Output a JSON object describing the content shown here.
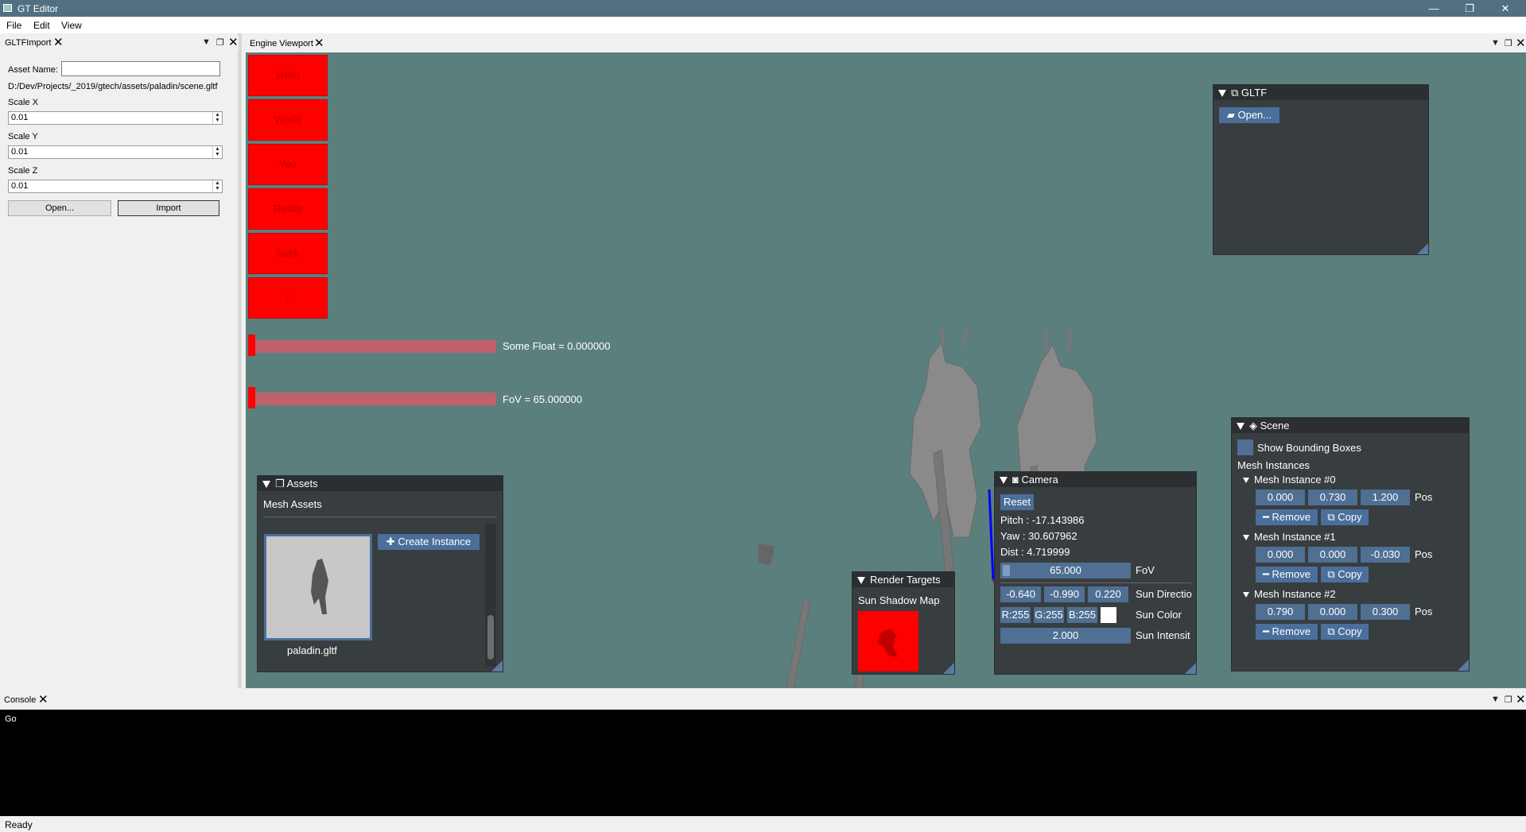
{
  "window": {
    "title": "GT Editor",
    "minimize": "—",
    "restore": "❐",
    "close": "✕"
  },
  "menu": {
    "items": [
      "File",
      "Edit",
      "View"
    ]
  },
  "gltf_import_panel": {
    "tab": "GLTFImport",
    "asset_name_label": "Asset Name:",
    "asset_name_value": "",
    "file_path": "D:/Dev/Projects/_2019/gtech/assets/paladin/scene.gltf",
    "scale_x_label": "Scale X",
    "scale_x": "0.01",
    "scale_y_label": "Scale Y",
    "scale_y": "0.01",
    "scale_z_label": "Scale Z",
    "scale_z": "0.01",
    "open_button": "Open...",
    "import_button": "Import"
  },
  "viewport": {
    "tab": "Engine Viewport",
    "red_buttons": [
      "Hello",
      "World",
      "You",
      "Really",
      "Suck",
      "!"
    ],
    "sliders": [
      {
        "label": "Some Float = 0.000000",
        "value_fraction": 0.0
      },
      {
        "label": "FoV = 65.000000",
        "value_fraction": 0.0
      }
    ]
  },
  "gltf_window": {
    "title": "GLTF",
    "open_button": "Open..."
  },
  "assets_window": {
    "title": "Assets",
    "section": "Mesh Assets",
    "create_instance": "Create Instance",
    "asset_name": "paladin.gltf"
  },
  "camera_window": {
    "title": "Camera",
    "reset": "Reset",
    "pitch": "Pitch : -17.143986",
    "yaw": "Yaw : 30.607962",
    "dist": "Dist : 4.719999",
    "fov_value": "65.000",
    "fov_label": "FoV",
    "sun_dir": [
      "-0.640",
      "-0.990",
      "0.220"
    ],
    "sun_dir_label": "Sun Directio",
    "sun_color": [
      "R:255",
      "G:255",
      "B:255"
    ],
    "sun_color_label": "Sun Color",
    "sun_color_swatch": "#ffffff",
    "sun_intensity": "2.000",
    "sun_intensity_label": "Sun Intensit"
  },
  "render_targets_window": {
    "title": "Render Targets",
    "item": "Sun Shadow Map"
  },
  "scene_window": {
    "title": "Scene",
    "show_bounding_boxes": "Show Bounding Boxes",
    "mesh_instances_label": "Mesh Instances",
    "instances": [
      {
        "name": "Mesh Instance #0",
        "pos": [
          "0.000",
          "0.730",
          "1.200"
        ]
      },
      {
        "name": "Mesh Instance #1",
        "pos": [
          "0.000",
          "0.000",
          "-0.030"
        ]
      },
      {
        "name": "Mesh Instance #2",
        "pos": [
          "0.790",
          "0.000",
          "0.300"
        ]
      }
    ],
    "pos_label": "Pos",
    "remove": "Remove",
    "copy": "Copy"
  },
  "console": {
    "tab": "Console",
    "text": "Go"
  },
  "status": {
    "text": "Ready"
  }
}
